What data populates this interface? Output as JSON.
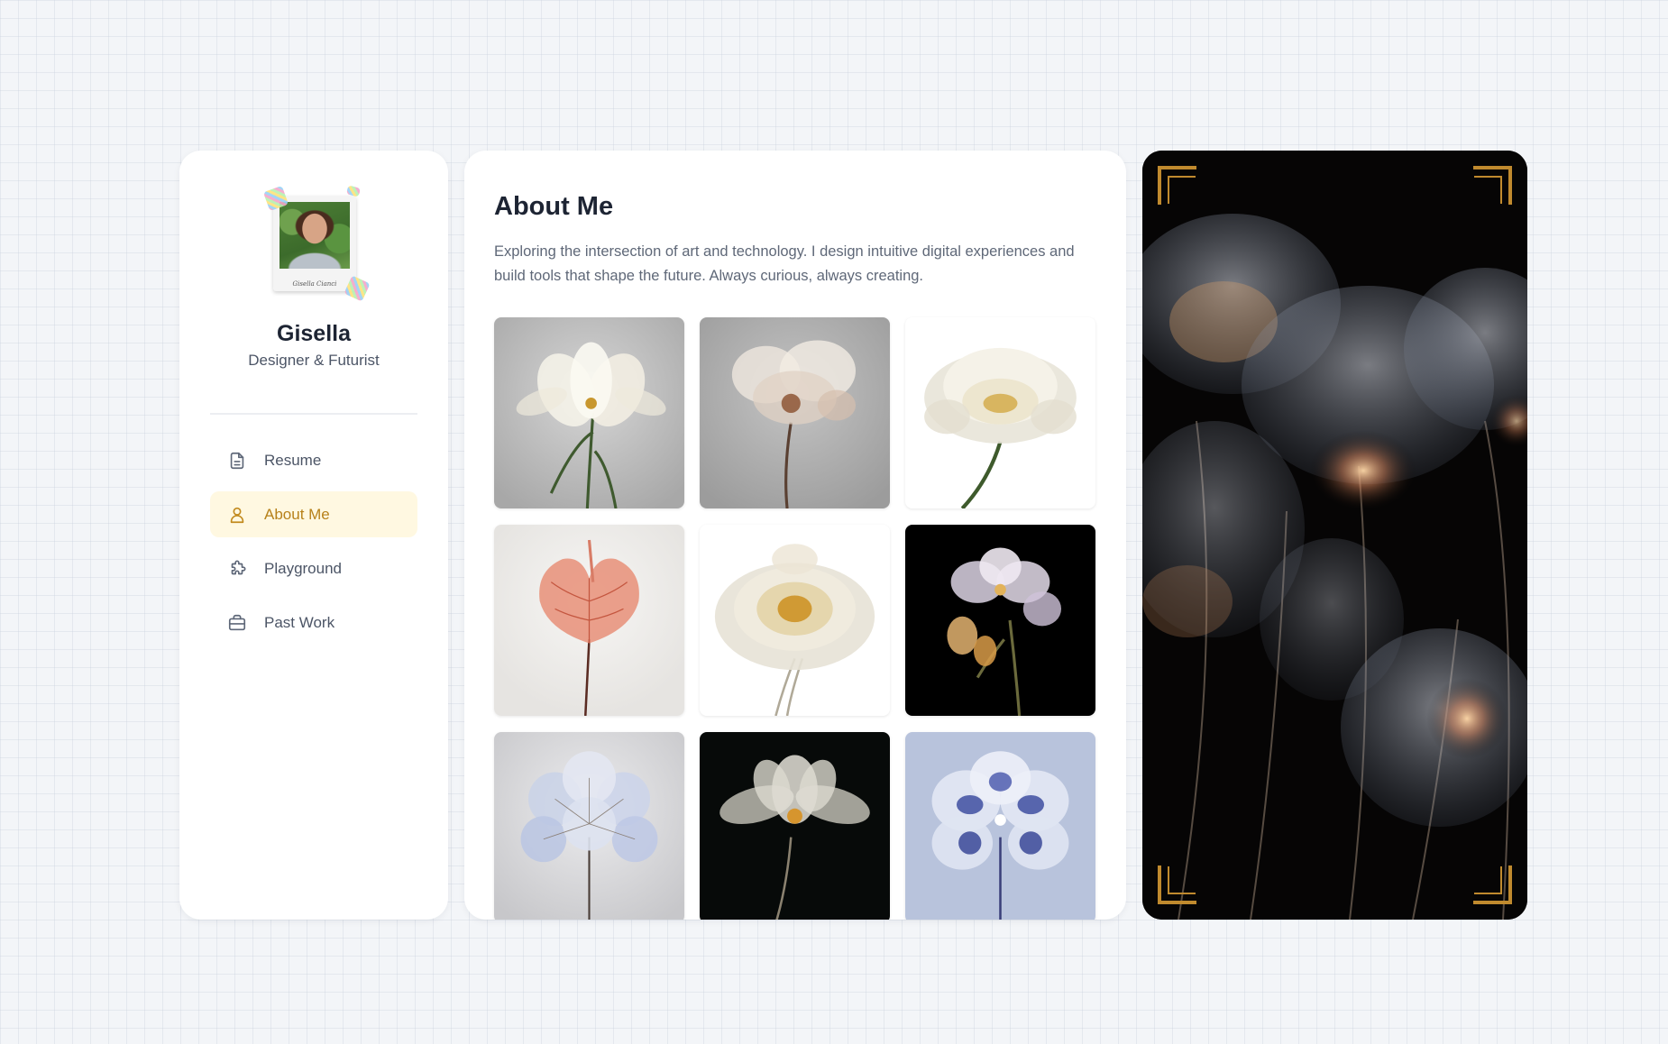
{
  "profile": {
    "name": "Gisella",
    "title": "Designer & Futurist",
    "photo_caption": "Gisella Cianci"
  },
  "nav": {
    "items": [
      {
        "label": "Resume",
        "icon": "document-icon",
        "active": false
      },
      {
        "label": "About Me",
        "icon": "user-icon",
        "active": true
      },
      {
        "label": "Playground",
        "icon": "puzzle-icon",
        "active": false
      },
      {
        "label": "Past Work",
        "icon": "briefcase-icon",
        "active": false
      }
    ]
  },
  "main": {
    "title": "About Me",
    "description": "Exploring the intersection of art and technology. I design intuitive digital experiences and build tools that shape the future. Always curious, always creating."
  },
  "gallery": {
    "images": [
      {
        "subject": "white tulip",
        "background": "#b8b8b8"
      },
      {
        "subject": "translucent poppy",
        "background": "#a9a9a9"
      },
      {
        "subject": "white peony",
        "background": "#ffffff"
      },
      {
        "subject": "red anthurium",
        "background": "#ecebe9"
      },
      {
        "subject": "golden dahlia",
        "background": "#ffffff"
      },
      {
        "subject": "glowing freesia",
        "background": "#000000"
      },
      {
        "subject": "blue hydrangea",
        "background": "#d4d4d6"
      },
      {
        "subject": "white anemone",
        "background": "#0a0d0c"
      },
      {
        "subject": "blue pansy",
        "background": "#b8c3dc"
      }
    ]
  },
  "colors": {
    "accent": "#c28a1e",
    "active_bg": "#fff8e1",
    "frame_gold": "#c08a2e",
    "page_bg": "#f3f5f8"
  }
}
